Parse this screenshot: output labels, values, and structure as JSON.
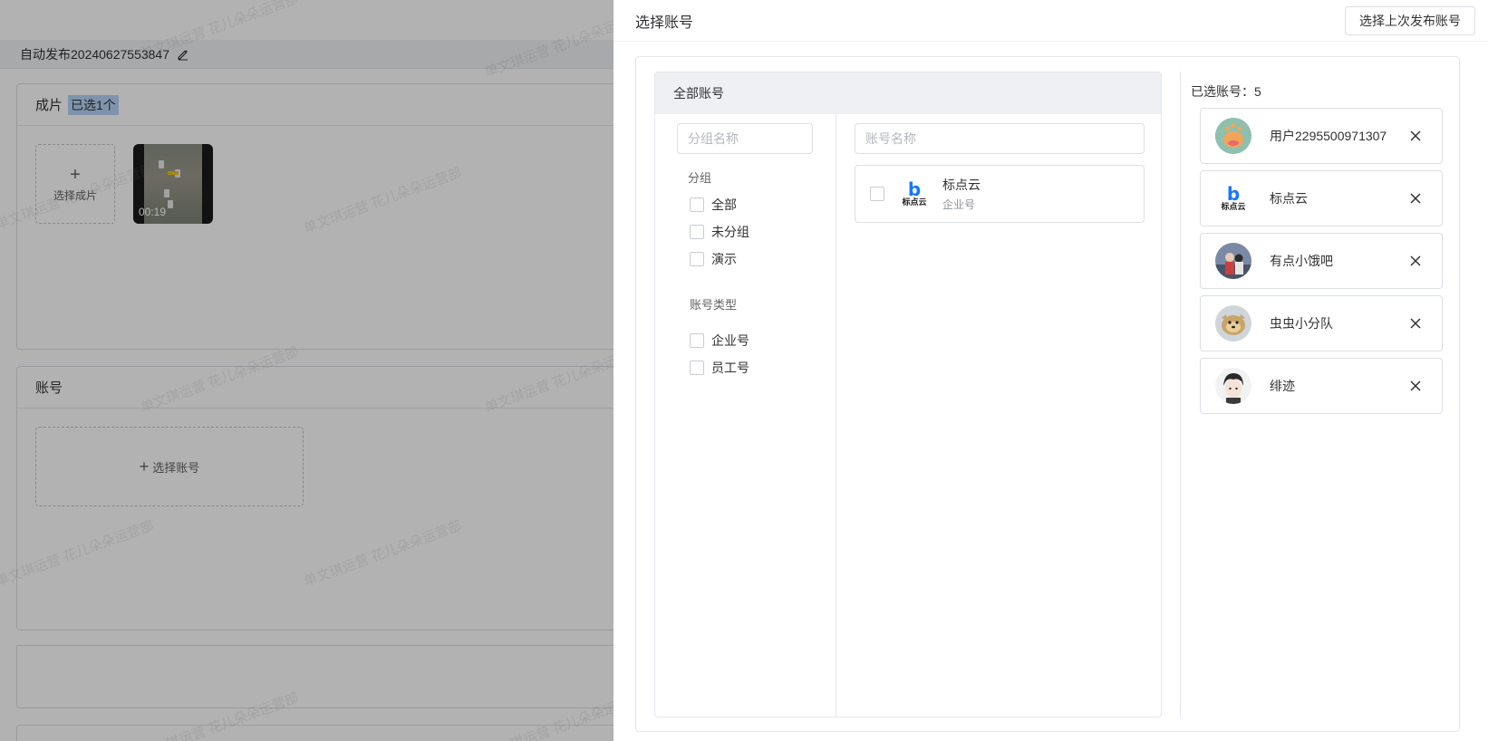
{
  "background": {
    "task_title": "自动发布20240627553847",
    "video_section": {
      "title": "成片",
      "selected_tag": "已选1个",
      "upload_label": "选择成片",
      "video_duration": "00:19"
    },
    "account_section": {
      "title": "账号",
      "select_label": "选择账号"
    },
    "watermark_text": "单文琪运营 花儿朵朵运营部"
  },
  "drawer": {
    "title": "选择账号",
    "last_publish_button": "选择上次发布账号",
    "all_accounts_header": "全部账号",
    "group_search_placeholder": "分组名称",
    "account_search_placeholder": "账号名称",
    "group_section_label": "分组",
    "groups": [
      {
        "label": "全部",
        "checked": false
      },
      {
        "label": "未分组",
        "checked": false
      },
      {
        "label": "演示",
        "checked": false
      }
    ],
    "type_section_label": "账号类型",
    "types": [
      {
        "label": "企业号",
        "checked": false
      },
      {
        "label": "员工号",
        "checked": false
      }
    ],
    "accounts": [
      {
        "name": "标点云",
        "type": "企业号",
        "logo_text": "标点云",
        "checked": false
      }
    ],
    "selected_label": "已选账号：",
    "selected_count": "5",
    "selected_accounts": [
      {
        "name": "用户2295500971307",
        "avatar": "cartoon-avatar"
      },
      {
        "name": "标点云",
        "avatar": "logo-avatar",
        "logo_text": "标点云"
      },
      {
        "name": "有点小饿吧",
        "avatar": "photo-avatar"
      },
      {
        "name": "虫虫小分队",
        "avatar": "pet-avatar"
      },
      {
        "name": "绯迹",
        "avatar": "anime-avatar"
      }
    ]
  },
  "colors": {
    "brand_blue": "#1677ff",
    "overlay": "rgba(0,0,0,0.30)",
    "border": "#dcdfe6",
    "header_bg": "#eff0f4"
  }
}
